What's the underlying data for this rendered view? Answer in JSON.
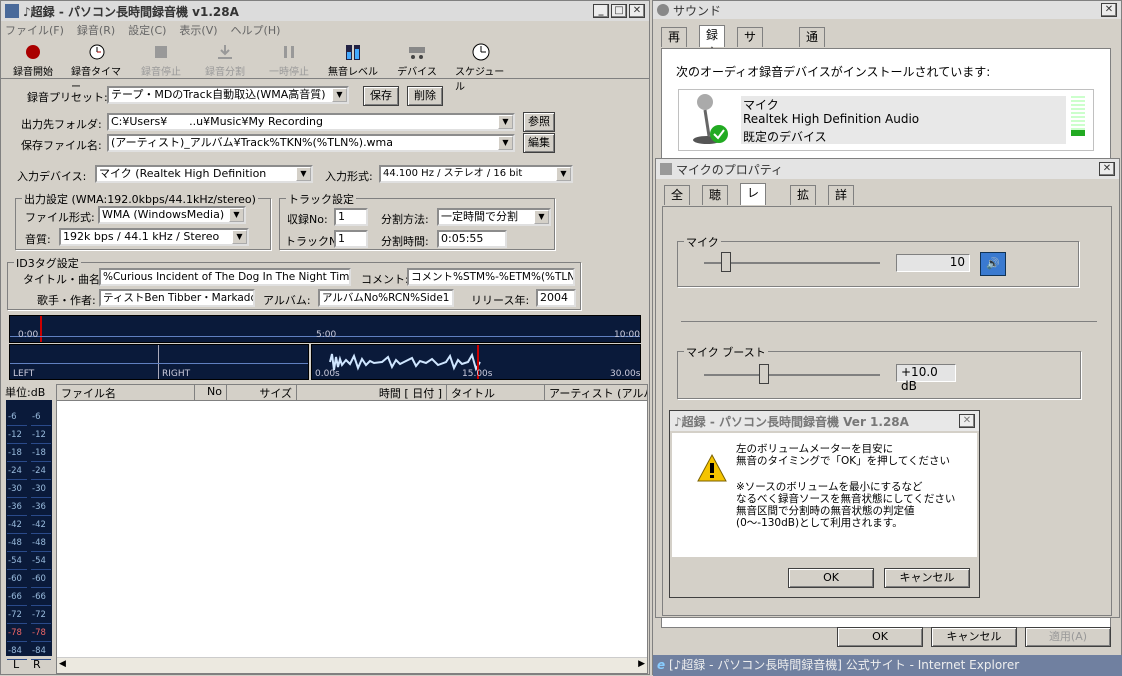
{
  "main": {
    "title": "♪超録 - パソコン長時間録音機 v1.28A",
    "menu": [
      "ファイル(F)",
      "録音(R)",
      "設定(C)",
      "表示(V)",
      "ヘルプ(H)"
    ],
    "toolbar": [
      "録音開始",
      "録音タイマー",
      "録音停止",
      "録音分割",
      "一時停止",
      "無音レベル",
      "デバイス",
      "スケジュール"
    ],
    "preset_label": "録音プリセット:",
    "preset_value": "テープ・MDのTrack自動取込(WMA高音質)",
    "save_btn": "保存",
    "delete_btn": "削除",
    "out_folder_label": "出力先フォルダ:",
    "out_folder_value": "C:¥Users¥　　..u¥Music¥My Recording",
    "browse_btn": "参照",
    "save_name_label": "保存ファイル名:",
    "save_name_value": "(アーティスト)_アルバム¥Track%TKN%(%TLN%).wma",
    "edit_btn": "編集",
    "in_device_label": "入力デバイス:",
    "in_device_value": "マイク (Realtek High Definition",
    "in_format_label": "入力形式:",
    "in_format_value": "44.100 Hz / ステレオ / 16 bit",
    "out_group": "出力設定 (WMA:192.0kbps/44.1kHz/stereo)",
    "file_type_label": "ファイル形式:",
    "file_type_value": "WMA (WindowsMedia)",
    "quality_label": "音質:",
    "quality_value": "192k bps / 44.1 kHz / Stereo",
    "track_group": "トラック設定",
    "rec_no_label": "収録No:",
    "rec_no_value": "1",
    "split_method_label": "分割方法:",
    "split_method_value": "一定時間で分割",
    "track_no_label": "トラックNo:",
    "track_no_value": "1",
    "split_time_label": "分割時間:",
    "split_time_value": "0:05:55",
    "id3_group": "ID3タグ設定",
    "title_label": "タイトル・曲名:",
    "title_value": "%Curious Incident of The Dog In The Night Time",
    "comment_label": "コメント:",
    "comment_value": "コメント%STM%-%ETM%(%TLN%)",
    "artist_label": "歌手・作者:",
    "artist_value": "ティストBen Tibber・Markaddon",
    "album_label": "アルバム:",
    "album_value": "アルバムNo%RCN%Side1",
    "year_label": "リリース年:",
    "year_value": "2004",
    "timeline": [
      "0:00",
      "5:00",
      "10:00"
    ],
    "wave_left": "LEFT",
    "wave_right": "RIGHT",
    "wave_ticks": [
      "0.00s",
      "15.00s",
      "30.00s"
    ],
    "unit_label": "単位:dB",
    "meter_scale": [
      "-6",
      "-12",
      "-18",
      "-24",
      "-30",
      "-36",
      "-42",
      "-48",
      "-54",
      "-60",
      "-66",
      "-72",
      "-78",
      "-84"
    ],
    "meter_lr": [
      "L",
      "R"
    ],
    "columns": [
      "ファイル名",
      "No",
      "サイズ",
      "時間 [ 日付 ]",
      "タイトル",
      "アーティスト (アルバム"
    ]
  },
  "sound": {
    "title": "サウンド",
    "tabs": [
      "再生",
      "録音",
      "サウンド",
      "通信"
    ],
    "selected_tab": 1,
    "desc": "次のオーディオ録音デバイスがインストールされています:",
    "device_name": "マイク",
    "device_driver": "Realtek High Definition Audio",
    "device_status": "既定のデバイス",
    "ok": "OK",
    "cancel": "キャンセル",
    "apply": "適用(A)"
  },
  "props": {
    "title": "マイクのプロパティ",
    "tabs": [
      "全般",
      "聴く",
      "レベル",
      "拡張",
      "詳細"
    ],
    "selected_tab": 2,
    "mic_group": "マイク",
    "mic_value": "10",
    "mic_level": 0.1,
    "boost_group": "マイク ブースト",
    "boost_value": "+10.0 dB",
    "boost_level": 0.33
  },
  "dialog": {
    "title": "♪超録 - パソコン長時間録音機 Ver 1.28A",
    "line1": "左のボリュームメーターを目安に",
    "line2": "無音のタイミングで「OK」を押してください",
    "line3": "※ソースのボリュームを最小にするなど",
    "line4": "なるべく録音ソースを無音状態にしてください",
    "line5": "無音区間で分割時の無音状態の判定値",
    "line6": "(0〜-130dB)として利用されます。",
    "ok": "OK",
    "cancel": "キャンセル"
  },
  "taskbar": {
    "ie_title": "[♪超録 - パソコン長時間録音機] 公式サイト - Internet Explorer"
  }
}
